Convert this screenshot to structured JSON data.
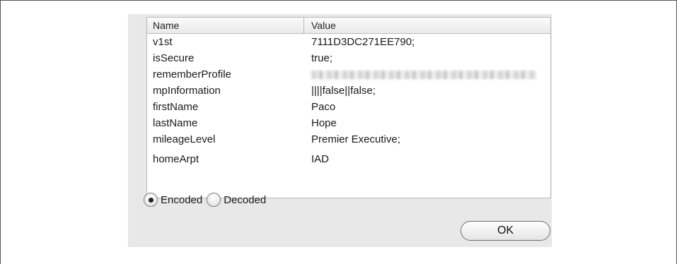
{
  "table": {
    "headers": {
      "name": "Name",
      "value": "Value"
    },
    "rows": [
      {
        "name": "v1st",
        "value": "7111D3DC271EE790;"
      },
      {
        "name": "isSecure",
        "value": "true;"
      },
      {
        "name": "rememberProfile",
        "value": "",
        "redacted": true
      },
      {
        "name": "mpInformation",
        "value": "||||false||false;"
      },
      {
        "name": "firstName",
        "value": "Paco"
      },
      {
        "name": "lastName",
        "value": "Hope"
      },
      {
        "name": "mileageLevel",
        "value": "Premier Executive;"
      },
      {
        "name": "homeArpt",
        "value": "IAD"
      }
    ]
  },
  "encoding": {
    "options": [
      "Encoded",
      "Decoded"
    ],
    "selected": "Encoded"
  },
  "buttons": {
    "ok_label": "OK"
  }
}
